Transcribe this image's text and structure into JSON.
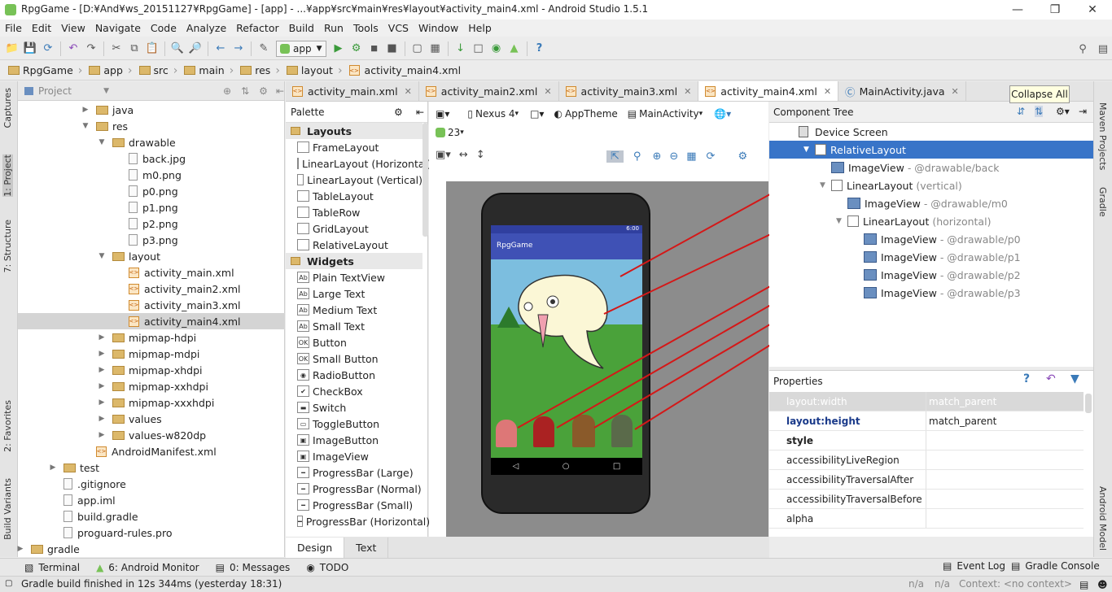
{
  "window": {
    "title": "RpgGame - [D:¥And¥ws_20151127¥RpgGame] - [app] - ...¥app¥src¥main¥res¥layout¥activity_main4.xml - Android Studio 1.5.1"
  },
  "menu": [
    "File",
    "Edit",
    "View",
    "Navigate",
    "Code",
    "Analyze",
    "Refactor",
    "Build",
    "Run",
    "Tools",
    "VCS",
    "Window",
    "Help"
  ],
  "toolbar": {
    "run_config": "app"
  },
  "breadcrumbs": [
    "RpgGame",
    "app",
    "src",
    "main",
    "res",
    "layout",
    "activity_main4.xml"
  ],
  "left_strip": [
    "1: Project",
    "Captures",
    "7: Structure",
    "2: Favorites",
    "Build Variants"
  ],
  "right_strip": [
    "Maven Projects",
    "Gradle",
    "Android Model"
  ],
  "project": {
    "header": "Project",
    "items": [
      {
        "label": "java",
        "indent": 0
      },
      {
        "label": "res",
        "indent": 0
      },
      {
        "label": "drawable",
        "indent": 1
      },
      {
        "label": "back.jpg",
        "indent": 2
      },
      {
        "label": "m0.png",
        "indent": 2
      },
      {
        "label": "p0.png",
        "indent": 2
      },
      {
        "label": "p1.png",
        "indent": 2
      },
      {
        "label": "p2.png",
        "indent": 2
      },
      {
        "label": "p3.png",
        "indent": 2
      },
      {
        "label": "layout",
        "indent": 1
      },
      {
        "label": "activity_main.xml",
        "indent": 2
      },
      {
        "label": "activity_main2.xml",
        "indent": 2
      },
      {
        "label": "activity_main3.xml",
        "indent": 2
      },
      {
        "label": "activity_main4.xml",
        "indent": 2
      },
      {
        "label": "mipmap-hdpi",
        "indent": 1
      },
      {
        "label": "mipmap-mdpi",
        "indent": 1
      },
      {
        "label": "mipmap-xhdpi",
        "indent": 1
      },
      {
        "label": "mipmap-xxhdpi",
        "indent": 1
      },
      {
        "label": "mipmap-xxxhdpi",
        "indent": 1
      },
      {
        "label": "values",
        "indent": 1
      },
      {
        "label": "values-w820dp",
        "indent": 1
      },
      {
        "label": "AndroidManifest.xml",
        "indent": 0
      },
      {
        "label": "test",
        "indent": -1
      },
      {
        "label": ".gitignore",
        "indent": -1
      },
      {
        "label": "app.iml",
        "indent": -1
      },
      {
        "label": "build.gradle",
        "indent": -1
      },
      {
        "label": "proguard-rules.pro",
        "indent": -1
      },
      {
        "label": "gradle",
        "indent": -2
      }
    ]
  },
  "tabs": [
    "activity_main.xml",
    "activity_main2.xml",
    "activity_main3.xml",
    "activity_main4.xml",
    "MainActivity.java"
  ],
  "palette": {
    "header": "Palette",
    "items": [
      {
        "label": "Layouts",
        "cat": true
      },
      {
        "label": "FrameLayout"
      },
      {
        "label": "LinearLayout (Horizontal)"
      },
      {
        "label": "LinearLayout (Vertical)"
      },
      {
        "label": "TableLayout"
      },
      {
        "label": "TableRow"
      },
      {
        "label": "GridLayout"
      },
      {
        "label": "RelativeLayout"
      },
      {
        "label": "Widgets",
        "cat": true
      },
      {
        "label": "Plain TextView",
        "ic": "Ab"
      },
      {
        "label": "Large Text",
        "ic": "Ab"
      },
      {
        "label": "Medium Text",
        "ic": "Ab"
      },
      {
        "label": "Small Text",
        "ic": "Ab"
      },
      {
        "label": "Button",
        "ic": "OK"
      },
      {
        "label": "Small Button",
        "ic": "OK"
      },
      {
        "label": "RadioButton",
        "ic": "◉"
      },
      {
        "label": "CheckBox",
        "ic": "✔"
      },
      {
        "label": "Switch",
        "ic": "▬"
      },
      {
        "label": "ToggleButton",
        "ic": "▭"
      },
      {
        "label": "ImageButton",
        "ic": "▣"
      },
      {
        "label": "ImageView",
        "ic": "▣"
      },
      {
        "label": "ProgressBar (Large)",
        "ic": "━"
      },
      {
        "label": "ProgressBar (Normal)",
        "ic": "━"
      },
      {
        "label": "ProgressBar (Small)",
        "ic": "━"
      },
      {
        "label": "ProgressBar (Horizontal)",
        "ic": "━"
      }
    ]
  },
  "design": {
    "device": "Nexus 4",
    "theme": "AppTheme",
    "activity": "MainActivity",
    "api": "23",
    "app_title": "RpgGame",
    "time": "6:00"
  },
  "component_tree": {
    "header": "Component Tree",
    "tooltip": "Collapse All",
    "items": [
      {
        "label": "Device Screen",
        "sub": "",
        "indent": 0,
        "icon": "device"
      },
      {
        "label": "RelativeLayout",
        "sub": "",
        "indent": 1,
        "icon": "rel",
        "selected": true
      },
      {
        "label": "ImageView",
        "sub": "- @drawable/back",
        "indent": 2,
        "icon": "img"
      },
      {
        "label": "LinearLayout",
        "sub": "(vertical)",
        "indent": 2,
        "icon": "lin"
      },
      {
        "label": "ImageView",
        "sub": "- @drawable/m0",
        "indent": 3,
        "icon": "img"
      },
      {
        "label": "LinearLayout",
        "sub": "(horizontal)",
        "indent": 3,
        "icon": "lin"
      },
      {
        "label": "ImageView",
        "sub": "- @drawable/p0",
        "indent": 4,
        "icon": "img"
      },
      {
        "label": "ImageView",
        "sub": "- @drawable/p1",
        "indent": 4,
        "icon": "img"
      },
      {
        "label": "ImageView",
        "sub": "- @drawable/p2",
        "indent": 4,
        "icon": "img"
      },
      {
        "label": "ImageView",
        "sub": "- @drawable/p3",
        "indent": 4,
        "icon": "img"
      }
    ]
  },
  "properties": {
    "header": "Properties",
    "rows": [
      {
        "k": "layout:width",
        "v": "match_parent",
        "dim": true
      },
      {
        "k": "layout:height",
        "v": "match_parent",
        "bold": true
      },
      {
        "k": "style",
        "v": "",
        "bold": true
      },
      {
        "k": "accessibilityLiveRegion",
        "v": ""
      },
      {
        "k": "accessibilityTraversalAfter",
        "v": ""
      },
      {
        "k": "accessibilityTraversalBefore",
        "v": ""
      },
      {
        "k": "alpha",
        "v": ""
      }
    ]
  },
  "bottom_tabs": [
    "Design",
    "Text"
  ],
  "tool_windows": {
    "left": [
      "Terminal",
      "6: Android Monitor",
      "0: Messages",
      "TODO"
    ],
    "right": [
      "Event Log",
      "Gradle Console"
    ]
  },
  "status": {
    "message": "Gradle build finished in 12s 344ms (yesterday 18:31)",
    "na1": "n/a",
    "na2": "n/a",
    "context": "Context: <no context>"
  }
}
